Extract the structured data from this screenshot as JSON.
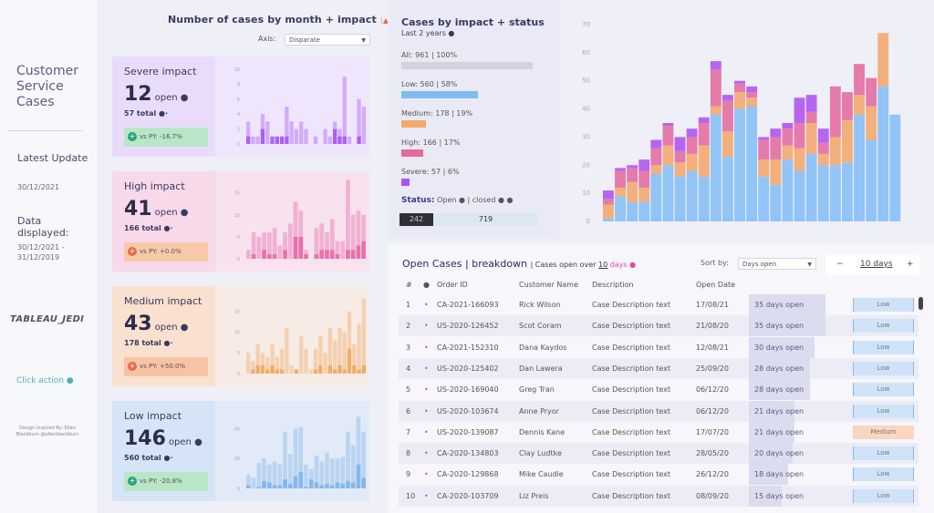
{
  "sidebar": {
    "title": "Customer Service Cases",
    "latest_update_label": "Latest Update",
    "latest_update_value": "30/12/2021",
    "data_displayed_label": "Data displayed:",
    "data_displayed_value": "30/12/2021 - 31/12/2019",
    "brand": "TABLEAU_JEDI",
    "click_action": "Click action ●",
    "credit": "Design inspired By: Ellen Blackburn @ellenblackburn"
  },
  "header": {
    "title": "Number of cases by month + impact",
    "up_icon": "▲",
    "down_icon": "▼",
    "axis_label": "Axis:",
    "axis_select": "Disparate"
  },
  "impact_cards": [
    {
      "title": "Severe impact",
      "open": "12",
      "open_label": "open ●",
      "total": "57 total ●·",
      "vs_py": "vs PY: -16.7%",
      "trend": "positive",
      "icon": "+",
      "color": "#a855f7",
      "bg": "#e9dcfb",
      "chart_bg": "#efe5fc",
      "badge_bg": "#b8e6c6",
      "badge_icon": "#2aa37a",
      "chart_data": {
        "type": "bar",
        "yticks": [
          "10",
          "8",
          "6",
          "4",
          "2",
          "0"
        ],
        "ylim": [
          0,
          10
        ],
        "total": [
          3,
          1,
          1,
          4,
          3,
          0,
          1,
          1,
          5,
          3,
          2,
          3,
          2,
          0,
          1,
          0,
          2,
          1,
          3,
          2,
          9,
          1,
          0,
          6,
          5
        ],
        "open": [
          1,
          0,
          0,
          2,
          0,
          1,
          1,
          1,
          1,
          0,
          0,
          0,
          0,
          0,
          0,
          0,
          0,
          0,
          2,
          1,
          1,
          0,
          0,
          1,
          0
        ]
      }
    },
    {
      "title": "High impact",
      "open": "41",
      "open_label": "open ●",
      "total": "166 total ●·",
      "vs_py": "vs PY: +0.0%",
      "trend": "negative",
      "icon": "+",
      "color": "#e56aa8",
      "bg": "#f7d9ea",
      "chart_bg": "#f7e2ee",
      "badge_bg": "#f8c9a8",
      "badge_icon": "#e26c4a",
      "chart_data": {
        "type": "bar",
        "yticks": [
          "15",
          "10",
          "5",
          "0"
        ],
        "ylim": [
          0,
          17
        ],
        "total": [
          2,
          6,
          5,
          6,
          6,
          7,
          3,
          6,
          8,
          13,
          11,
          2,
          0,
          7,
          8,
          6,
          9,
          4,
          4,
          18,
          10,
          11,
          10
        ],
        "open": [
          0,
          1,
          0,
          2,
          1,
          1,
          0,
          2,
          0,
          5,
          5,
          1,
          0,
          1,
          2,
          2,
          2,
          1,
          0,
          2,
          2,
          3,
          4
        ]
      }
    },
    {
      "title": "Medium impact",
      "open": "43",
      "open_label": "open ●",
      "total": "178 total ●·",
      "vs_py": "vs PY: +50.0%",
      "trend": "negative",
      "icon": "+",
      "color": "#f0a860",
      "bg": "#f9e0cf",
      "chart_bg": "#f7ebe5",
      "badge_bg": "#f8c3a4",
      "badge_icon": "#e26c4a",
      "chart_data": {
        "type": "bar",
        "yticks": [
          "15",
          "10",
          "5",
          "0"
        ],
        "ylim": [
          0,
          18
        ],
        "total": [
          5,
          3,
          7,
          5,
          4,
          7,
          4,
          6,
          11,
          2,
          1,
          9,
          6,
          1,
          6,
          9,
          5,
          11,
          8,
          11,
          10,
          15,
          7,
          12,
          18
        ],
        "open": [
          0,
          1,
          2,
          2,
          1,
          2,
          1,
          1,
          0,
          0,
          1,
          0,
          0,
          0,
          1,
          2,
          0,
          2,
          1,
          2,
          1,
          6,
          2,
          1,
          2
        ]
      }
    },
    {
      "title": "Low impact",
      "open": "146",
      "open_label": "open ●",
      "total": "560 total ●·",
      "vs_py": "vs PY: -20.8%",
      "trend": "positive",
      "icon": "+",
      "color": "#7fb5ea",
      "bg": "#d6e4f7",
      "chart_bg": "#e2eaf7",
      "badge_bg": "#b8e6c6",
      "badge_icon": "#2aa37a",
      "chart_data": {
        "type": "bar",
        "yticks": [
          "40",
          "20",
          "0"
        ],
        "ylim": [
          0,
          50
        ],
        "total": [
          9,
          7,
          17,
          20,
          16,
          18,
          16,
          38,
          23,
          40,
          41,
          16,
          13,
          22,
          18,
          24,
          20,
          20,
          21,
          38,
          29,
          48,
          38
        ],
        "open": [
          2,
          0,
          1,
          5,
          4,
          2,
          2,
          6,
          3,
          8,
          11,
          1,
          6,
          4,
          2,
          3,
          2,
          4,
          3,
          5,
          4,
          16,
          7
        ]
      }
    }
  ],
  "impact_status": {
    "title": "Cases by impact + status",
    "subtitle": "Last 2 years ●",
    "rows": [
      {
        "label": "All: 961 | 100%",
        "value": 961,
        "pct": 1.0,
        "color": "#d3d3df"
      },
      {
        "label": "Low: 560 | 58%",
        "value": 560,
        "pct": 0.58,
        "color": "#7fbaf0"
      },
      {
        "label": "Medium: 178 | 19%",
        "value": 178,
        "pct": 0.19,
        "color": "#f3a96a"
      },
      {
        "label": "High: 166 | 17%",
        "value": 166,
        "pct": 0.17,
        "color": "#e86a9a"
      },
      {
        "label": "Severe: 57 | 6%",
        "value": 57,
        "pct": 0.06,
        "color": "#a855f7"
      }
    ],
    "status_label": "Status:",
    "status_legend": "Open ● | closed ● ●",
    "open_count": "242",
    "closed_count": "719"
  },
  "chart_data": {
    "type": "bar",
    "stacked": true,
    "title": "",
    "yticks": [
      "70",
      "60",
      "50",
      "40",
      "30",
      "20",
      "10",
      "0"
    ],
    "ylim": [
      0,
      70
    ],
    "series": [
      {
        "name": "Low",
        "color": "#92c4f5",
        "values": [
          1,
          9,
          7,
          7,
          17,
          20,
          16,
          18,
          16,
          38,
          23,
          40,
          41,
          16,
          13,
          22,
          18,
          24,
          20,
          20,
          21,
          38,
          29,
          48,
          38
        ]
      },
      {
        "name": "Medium",
        "color": "#f3b07c",
        "values": [
          5,
          3,
          7,
          5,
          3,
          7,
          5,
          6,
          11,
          3,
          9,
          6,
          3,
          6,
          9,
          5,
          8,
          11,
          4,
          10,
          15,
          7,
          12,
          19,
          0
        ]
      },
      {
        "name": "High",
        "color": "#e57bab",
        "values": [
          2,
          6,
          5,
          6,
          6,
          7,
          4,
          6,
          8,
          13,
          11,
          3,
          2,
          7,
          8,
          6,
          9,
          4,
          4,
          18,
          10,
          11,
          10,
          0,
          0
        ]
      },
      {
        "name": "Severe",
        "color": "#b665f2",
        "values": [
          3,
          1,
          1,
          4,
          3,
          1,
          5,
          3,
          2,
          3,
          2,
          1,
          2,
          1,
          3,
          2,
          9,
          6,
          5,
          0,
          0,
          0,
          0,
          0,
          0
        ]
      }
    ]
  },
  "open_cases": {
    "title": "Open Cases | breakdown",
    "subtitle_prefix": "| Cases open over ",
    "subtitle_days": "10",
    "subtitle_suffix": " days ●",
    "sort_label": "Sort by:",
    "sort_value": "Days open",
    "stepper_minus": "−",
    "stepper_value": "10 days",
    "stepper_plus": "+",
    "columns": [
      "#",
      "●",
      "Order ID",
      "Customer Name",
      "Description",
      "Open Date"
    ],
    "rows": [
      {
        "n": "1",
        "order": "CA-2021-166093",
        "name": "Rick Wilson",
        "desc": "Case Description text",
        "date": "17/08/21",
        "days": "35 days open",
        "days_num": 35,
        "impact": "Low"
      },
      {
        "n": "2",
        "order": "US-2020-126452",
        "name": "Scot Coram",
        "desc": "Case Description text",
        "date": "21/08/20",
        "days": "35 days open",
        "days_num": 35,
        "impact": "Low"
      },
      {
        "n": "3",
        "order": "CA-2021-152310",
        "name": "Dana Kaydos",
        "desc": "Case Description text",
        "date": "12/08/21",
        "days": "30 days open",
        "days_num": 30,
        "impact": "Low"
      },
      {
        "n": "4",
        "order": "US-2020-125402",
        "name": "Dan Lawera",
        "desc": "Case Description text",
        "date": "25/09/20",
        "days": "28 days open",
        "days_num": 28,
        "impact": "Low"
      },
      {
        "n": "5",
        "order": "US-2020-169040",
        "name": "Greg Tran",
        "desc": "Case Description text",
        "date": "06/12/20",
        "days": "28 days open",
        "days_num": 28,
        "impact": "Low"
      },
      {
        "n": "6",
        "order": "US-2020-103674",
        "name": "Anne Pryor",
        "desc": "Case Description text",
        "date": "06/12/20",
        "days": "21 days open",
        "days_num": 21,
        "impact": "Low"
      },
      {
        "n": "7",
        "order": "US-2020-139087",
        "name": "Dennis Kane",
        "desc": "Case Description text",
        "date": "17/07/20",
        "days": "21 days open",
        "days_num": 21,
        "impact": "Medium"
      },
      {
        "n": "8",
        "order": "CA-2020-134803",
        "name": "Clay Ludtke",
        "desc": "Case Description text",
        "date": "28/05/20",
        "days": "20 days open",
        "days_num": 20,
        "impact": "Low"
      },
      {
        "n": "9",
        "order": "CA-2020-129868",
        "name": "Mike Caudle",
        "desc": "Case Description text",
        "date": "26/12/20",
        "days": "18 days open",
        "days_num": 18,
        "impact": "Low"
      },
      {
        "n": "10",
        "order": "CA-2020-103709",
        "name": "Liz Preis",
        "desc": "Case Description text",
        "date": "08/09/20",
        "days": "15 days open",
        "days_num": 15,
        "impact": "Low"
      }
    ]
  }
}
